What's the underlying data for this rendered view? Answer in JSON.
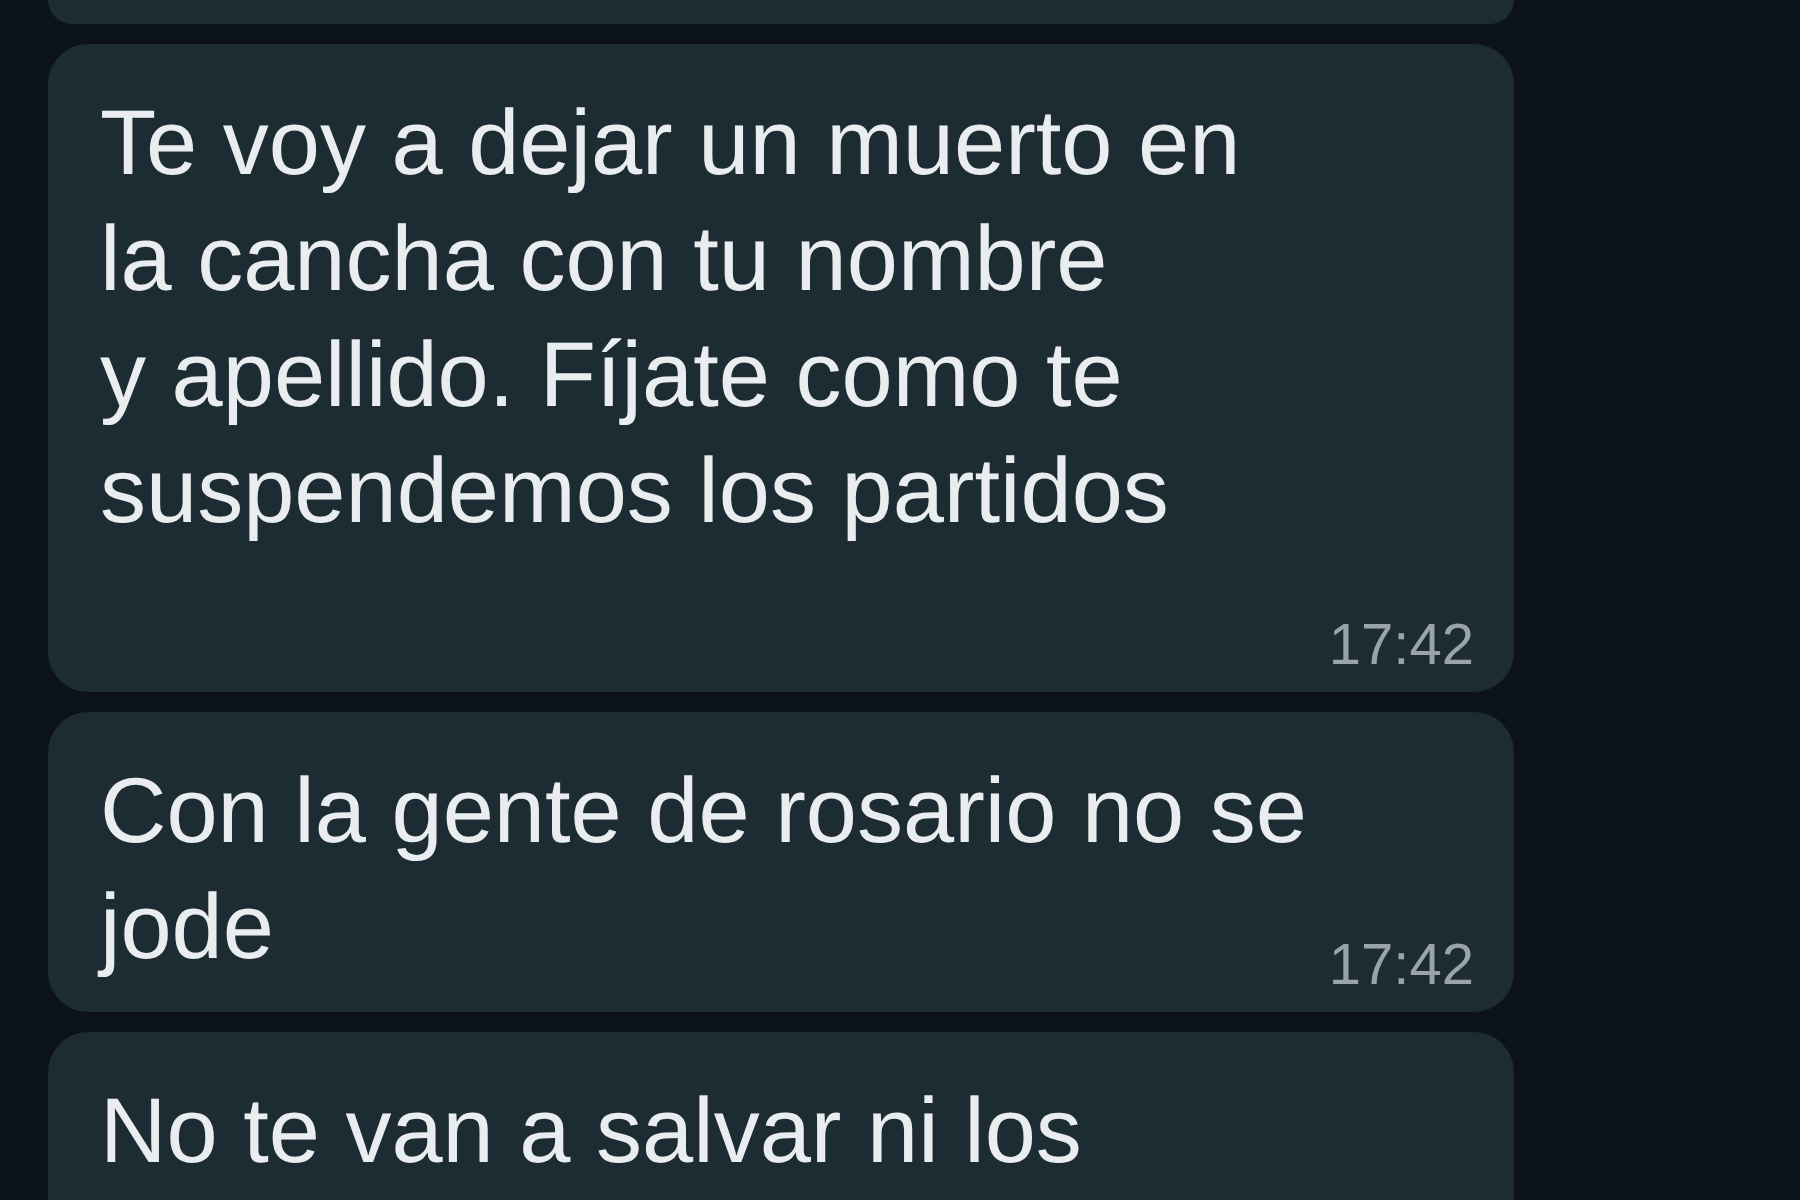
{
  "messages": [
    {
      "kind": "cut_top"
    },
    {
      "kind": "full",
      "text": "Te voy a dejar un muerto en\nla cancha con tu nombre\ny apellido. Fíjate como te\nsuspendemos los partidos",
      "time": "17:42"
    },
    {
      "kind": "full",
      "text": "Con la gente de rosario no se\njode",
      "time": "17:42"
    },
    {
      "kind": "cut_bottom",
      "text": "No te van a salvar ni los"
    }
  ]
}
